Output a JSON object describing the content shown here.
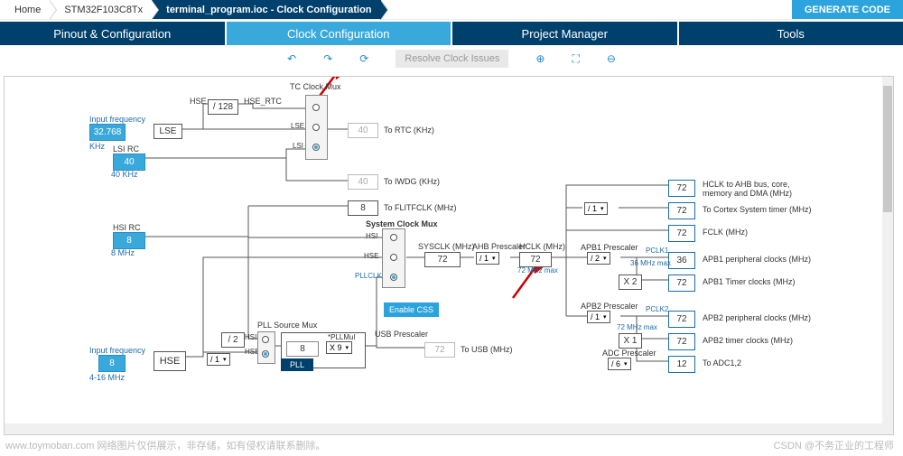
{
  "breadcrumb": {
    "home": "Home",
    "chip": "STM32F103C8Tx",
    "file": "terminal_program.ioc - Clock Configuration",
    "generate": "GENERATE CODE"
  },
  "tabs": {
    "pinout": "Pinout & Configuration",
    "clock": "Clock Configuration",
    "project": "Project Manager",
    "tools": "Tools"
  },
  "toolbar": {
    "resolve": "Resolve Clock Issues"
  },
  "clocks": {
    "input_freq_label": "Input frequency",
    "lse_val": "32.768",
    "lse_unit": "KHz",
    "lse": "LSE",
    "lsi_rc": "LSI RC",
    "lsi_val": "40",
    "lsi_unit": "40 KHz",
    "hsi_rc": "HSI RC",
    "hsi_val": "8",
    "hsi_unit": "8 MHz",
    "hse_val": "8",
    "hse": "HSE",
    "hse_range": "4-16 MHz",
    "div128": "/ 128",
    "hse_rtc": "HSE_RTC",
    "rtc_mux_title": "TC Clock Mux",
    "to_rtc": "To RTC (KHz)",
    "rtc_val": "40",
    "to_iwdg": "To IWDG (KHz)",
    "iwdg_val": "40",
    "flitf_val": "8",
    "to_flitf": "To FLITFCLK (MHz)",
    "sys_mux_title": "System Clock Mux",
    "hsi_label": "HSI",
    "hse_label": "HSE",
    "lse_label": "LSE",
    "lsi_label": "LSI",
    "pllclk": "PLLCLK",
    "sysclk": "SYSCLK (MHz)",
    "sysclk_val": "72",
    "ahb_presc": "AHB Prescaler",
    "ahb_val": "/ 1",
    "hclk": "HCLK (MHz)",
    "hclk_val": "72",
    "hclk_max": "72 MHz max",
    "css": "Enable CSS",
    "pll_src": "PLL Source Mux",
    "div2": "/ 2",
    "div1": "/ 1",
    "pllmul": "*PLLMul",
    "pllmul_val": "X 9",
    "pll_val": "8",
    "pll": "PLL",
    "usb_presc": "USB Prescaler",
    "to_usb": "To USB (MHz)",
    "usb_val": "72",
    "apb1_presc": "APB1 Prescaler",
    "apb1_val": "/ 2",
    "apb1_x": "X 2",
    "pclk1": "PCLK1",
    "pclk1_max": "36 MHz max",
    "apb1_periph": "APB1 peripheral clocks (MHz)",
    "apb1_periph_val": "36",
    "apb1_timer": "APB1 Timer clocks (MHz)",
    "apb1_timer_val": "72",
    "apb2_presc": "APB2 Prescaler",
    "apb2_val": "/ 1",
    "apb2_x": "X 1",
    "pclk2": "PCLK2",
    "pclk2_max": "72 MHz max",
    "apb2_periph": "APB2 peripheral clocks (MHz)",
    "apb2_periph_val": "72",
    "apb2_timer": "APB2 timer clocks (MHz)",
    "apb2_timer_val": "72",
    "adc_presc": "ADC Prescaler",
    "adc_val": "/ 6",
    "to_adc": "To ADC1,2",
    "adc_out": "12",
    "hclk_ahb": "HCLK to AHB bus, core, memory and DMA (MHz)",
    "hclk_ahb_val": "72",
    "cortex": "To Cortex System timer (MHz)",
    "cortex_div": "/ 1",
    "cortex_val": "72",
    "fclk": "FCLK (MHz)",
    "fclk_val": "72"
  },
  "watermark": {
    "left": "www.toymoban.com  网络图片仅供展示，非存储，如有侵权请联系删除。",
    "right": "CSDN @不务正业的工程师"
  }
}
